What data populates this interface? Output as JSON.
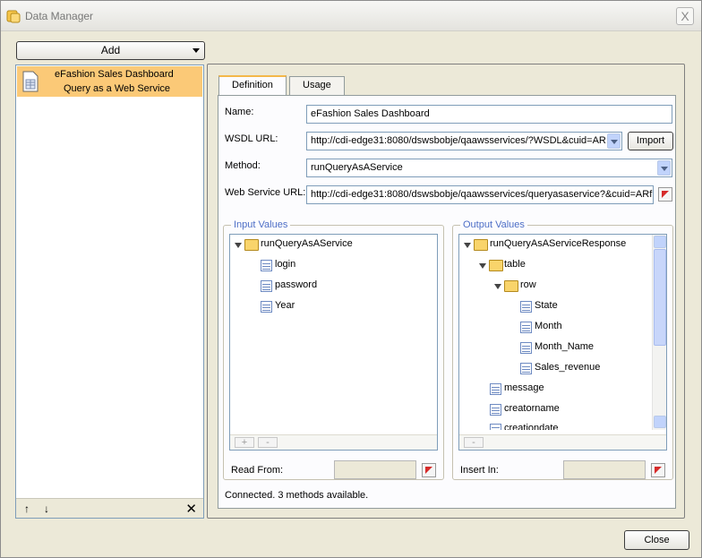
{
  "window": {
    "title": "Data Manager",
    "close_glyph": "X"
  },
  "left": {
    "add_label": "Add",
    "items": [
      {
        "line1": "eFashion Sales Dashboard",
        "line2": "Query as a Web Service",
        "icon": "document-icon",
        "selected": true
      }
    ],
    "toolbar": {
      "up": "↑",
      "down": "↓",
      "delete": "✕"
    }
  },
  "tabs": [
    {
      "label": "Definition",
      "active": true
    },
    {
      "label": "Usage",
      "active": false
    }
  ],
  "form": {
    "name_label": "Name:",
    "name_value": "eFashion Sales Dashboard",
    "wsdl_label": "WSDL URL:",
    "wsdl_value": "http://cdi-edge31:8080/dswsbobje/qaawsservices/?WSDL&cuid=AR",
    "import_label": "Import",
    "method_label": "Method:",
    "method_value": "runQueryAsAService",
    "ws_url_label": "Web Service URL:",
    "ws_url_value": "http://cdi-edge31:8080/dswsbobje/qaawsservices/queryasaservice?&cuid=ARf"
  },
  "input_values": {
    "title": "Input Values",
    "root": "runQueryAsAService",
    "children": [
      "login",
      "password",
      "Year"
    ],
    "plus": "+",
    "minus": "-",
    "read_from_label": "Read From:"
  },
  "output_values": {
    "title": "Output Values",
    "root": "runQueryAsAServiceResponse",
    "table": "table",
    "row": "row",
    "row_children": [
      "State",
      "Month",
      "Month_Name",
      "Sales_revenue"
    ],
    "siblings": [
      "message",
      "creatorname",
      "creationdate"
    ],
    "minus": "-",
    "insert_in_label": "Insert In:"
  },
  "status": "Connected. 3 methods available.",
  "close_label": "Close",
  "colors": {
    "selected_item": "#fbc977",
    "group_title": "#4d6ec6",
    "active_tab_top": "#f4b84a"
  }
}
